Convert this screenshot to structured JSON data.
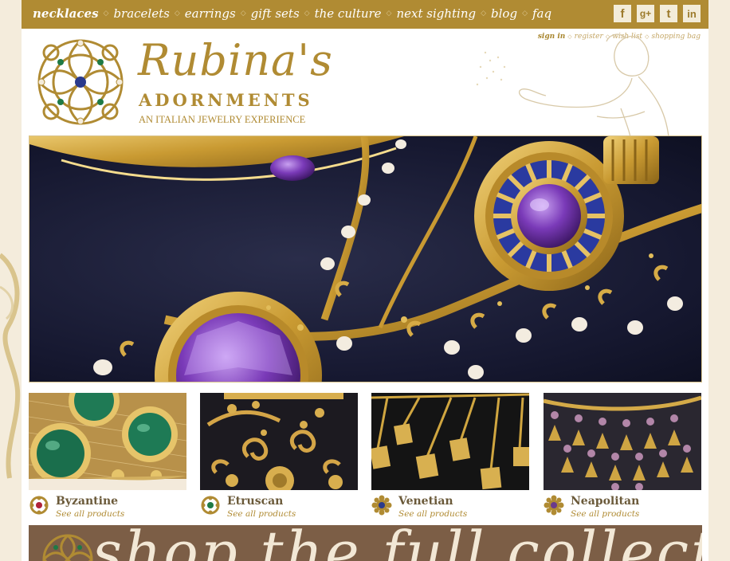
{
  "nav": {
    "items": [
      "necklaces",
      "bracelets",
      "earrings",
      "gift sets",
      "the culture",
      "next sighting",
      "blog",
      "faq"
    ],
    "active": "necklaces",
    "social": [
      {
        "name": "facebook",
        "glyph": "f"
      },
      {
        "name": "google-plus",
        "glyph": "g+"
      },
      {
        "name": "twitter",
        "glyph": "t"
      },
      {
        "name": "linkedin",
        "glyph": "in"
      }
    ]
  },
  "account": {
    "sign_in": "sign in",
    "register": "register",
    "wish_list": "wish list",
    "shopping_bag": "shopping bag"
  },
  "brand": {
    "script": "Rubina's",
    "name": "ADORNMENTS",
    "tagline": "AN ITALIAN JEWELRY EXPERIENCE"
  },
  "products": [
    {
      "title": "Byzantine",
      "link": "See all products",
      "gem_color": "#b0243a"
    },
    {
      "title": "Etruscan",
      "link": "See all products",
      "gem_color": "#1f7a45"
    },
    {
      "title": "Venetian",
      "link": "See all products",
      "gem_color": "#2a3a8c"
    },
    {
      "title": "Neapolitan",
      "link": "See all products",
      "gem_color": "#6a3a8c"
    }
  ],
  "banner": {
    "text": "shop the full collection"
  },
  "colors": {
    "gold": "#b08b33",
    "brown": "#7c5e46",
    "cream": "#f4ecdc"
  }
}
